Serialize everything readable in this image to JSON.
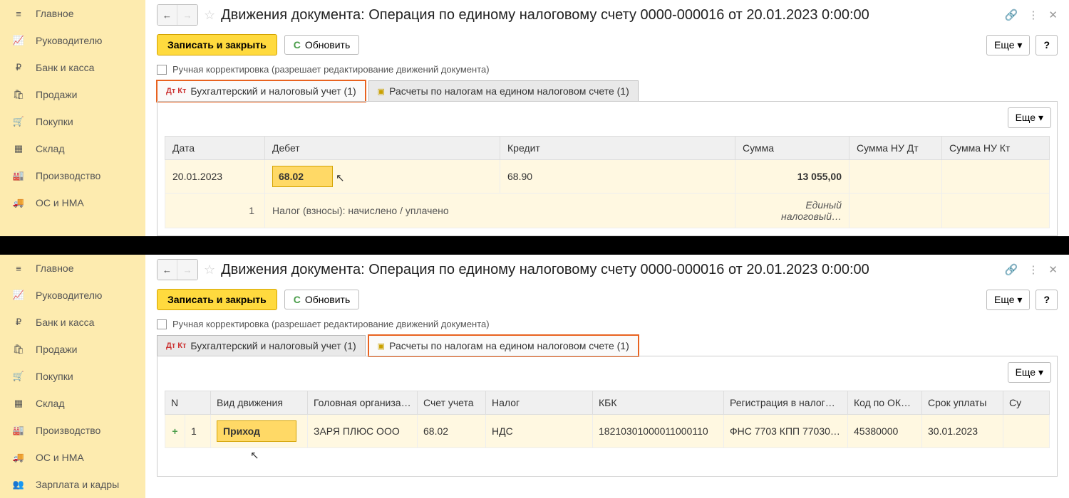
{
  "sidebar": {
    "items1": [
      "Главное",
      "Руководителю",
      "Банк и касса",
      "Продажи",
      "Покупки",
      "Склад",
      "Производство",
      "ОС и НМА"
    ],
    "items2": [
      "Главное",
      "Руководителю",
      "Банк и касса",
      "Продажи",
      "Покупки",
      "Склад",
      "Производство",
      "ОС и НМА",
      "Зарплата и кадры"
    ]
  },
  "title": "Движения документа: Операция по единому налоговому счету 0000-000016 от 20.01.2023 0:00:00",
  "cmdbar": {
    "save": "Записать и закрыть",
    "refresh": "Обновить",
    "more": "Еще ▾",
    "help": "?"
  },
  "checkbox_label": "Ручная корректировка (разрешает редактирование движений документа)",
  "tabs": {
    "t1": "Бухгалтерский и налоговый учет (1)",
    "t2": "Расчеты по налогам на едином налоговом счете (1)"
  },
  "panel_more": "Еще ▾",
  "grid1": {
    "headers": {
      "c1": "Дата",
      "c2": "Дебет",
      "c3": "Кредит",
      "c4": "Сумма",
      "c5": "Сумма НУ Дт",
      "c6": "Сумма НУ Кт"
    },
    "row": {
      "date": "20.01.2023",
      "debit": "68.02",
      "credit": "68.90",
      "sum": "13 055,00"
    },
    "sub": {
      "num": "1",
      "debit_txt": "Налог (взносы): начислено / уплачено",
      "sum_txt": "Единый налоговый…"
    }
  },
  "grid2": {
    "headers": {
      "n": "N",
      "type": "Вид движения",
      "org": "Головная организа…",
      "acct": "Счет учета",
      "tax": "Налог",
      "kbk": "КБК",
      "reg": "Регистрация в налог…",
      "okt": "Код по ОК…",
      "due": "Срок уплаты",
      "su": "Су"
    },
    "row": {
      "plus": "+",
      "n": "1",
      "type": "Приход",
      "org": "ЗАРЯ ПЛЮС ООО",
      "acct": "68.02",
      "tax": "НДС",
      "kbk": "18210301000011000110",
      "reg": "ФНС 7703 КПП 77030…",
      "okt": "45380000",
      "due": "30.01.2023"
    }
  }
}
